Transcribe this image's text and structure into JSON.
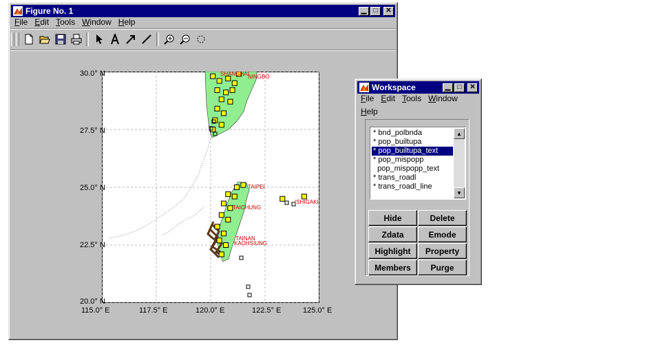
{
  "figure_window": {
    "title": "Figure No. 1",
    "menu": [
      "File",
      "Edit",
      "Tools",
      "Window",
      "Help"
    ],
    "menu_mnemonics": [
      "F",
      "E",
      "T",
      "W",
      "H"
    ],
    "toolbar_icons": [
      "new-file-icon",
      "open-folder-icon",
      "save-icon",
      "print-icon",
      "arrow-select-icon",
      "text-insert-icon",
      "arrow-insert-icon",
      "line-insert-icon",
      "zoom-in-icon",
      "zoom-out-icon",
      "rotate-icon"
    ],
    "window_buttons": [
      "minimize",
      "maximize",
      "close"
    ]
  },
  "map": {
    "text_labels": [
      "SHANGHAI",
      "NINGBO",
      "TAIPEI",
      "TAICHUNG",
      "TAINAN",
      "KAOHSIUNG",
      "ISHIGAKI"
    ]
  },
  "chart_data": {
    "type": "scatter",
    "title": "",
    "xlim": [
      115.0,
      125.0
    ],
    "ylim": [
      20.0,
      30.0
    ],
    "x_ticks": [
      115.0,
      117.5,
      120.0,
      122.5,
      125.0
    ],
    "y_ticks": [
      20.0,
      22.5,
      25.0,
      27.5,
      30.0
    ],
    "x_tick_labels": [
      "115.0° E",
      "117.5° E",
      "120.0° E",
      "122.5° E",
      "125.0° E"
    ],
    "y_tick_labels": [
      "20.0° N",
      "22.5° N",
      "25.0° N",
      "27.5° N",
      "30.0° N"
    ],
    "grid": true,
    "series": [
      {
        "marker": "square",
        "color": "#ffff00",
        "points": [
          [
            120.1,
            29.8
          ],
          [
            120.4,
            29.6
          ],
          [
            120.8,
            29.7
          ],
          [
            121.1,
            29.5
          ],
          [
            121.3,
            29.9
          ],
          [
            120.3,
            29.2
          ],
          [
            120.7,
            29.1
          ],
          [
            121.0,
            29.2
          ],
          [
            120.5,
            28.8
          ],
          [
            120.9,
            28.7
          ],
          [
            120.3,
            28.4
          ],
          [
            120.6,
            28.2
          ],
          [
            120.2,
            27.9
          ],
          [
            120.5,
            27.7
          ],
          [
            120.1,
            27.5
          ],
          [
            121.2,
            25.0
          ],
          [
            121.5,
            25.1
          ],
          [
            120.8,
            24.7
          ],
          [
            121.1,
            24.6
          ],
          [
            120.6,
            24.3
          ],
          [
            120.9,
            24.1
          ],
          [
            120.5,
            23.8
          ],
          [
            120.8,
            23.6
          ],
          [
            120.3,
            23.3
          ],
          [
            120.6,
            23.0
          ],
          [
            120.4,
            22.7
          ],
          [
            120.7,
            22.5
          ],
          [
            120.5,
            22.1
          ],
          [
            123.3,
            24.5
          ],
          [
            124.3,
            24.6
          ]
        ]
      }
    ]
  },
  "workspace_window": {
    "title": "Workspace",
    "menu": [
      "File",
      "Edit",
      "Tools",
      "Window",
      "Help"
    ],
    "menu_mnemonics": [
      "F",
      "E",
      "T",
      "W",
      "H"
    ],
    "layers": [
      {
        "label": "* bnd_polbnda",
        "selected": false
      },
      {
        "label": "* pop_builtupa",
        "selected": false
      },
      {
        "label": "* pop_builtupa_text",
        "selected": true
      },
      {
        "label": "* pop_mispopp",
        "selected": false
      },
      {
        "label": "  pop_mispopp_text",
        "selected": false
      },
      {
        "label": "* trans_roadl",
        "selected": false
      },
      {
        "label": "* trans_roadl_line",
        "selected": false
      }
    ],
    "buttons": [
      "Hide",
      "Delete",
      "Zdata",
      "Emode",
      "Highlight",
      "Property",
      "Members",
      "Purge"
    ]
  },
  "colors": {
    "title_bar": "#000080",
    "window_face": "#c0c0c0",
    "land_fill": "#90ee90",
    "marker_fill": "#ffff00",
    "label_red": "#cc0000",
    "selection": "#000080"
  }
}
